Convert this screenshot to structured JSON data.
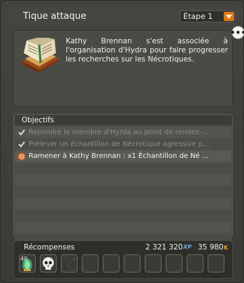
{
  "header": {
    "title": "Tique attaque",
    "step_selected": "Étape 1"
  },
  "description": {
    "text": "Kathy Brennan s'est associée à l'organisation d'Hydra pour faire progresser les recherches sur les Nécrotiques."
  },
  "objectives": {
    "header": "Objectifs",
    "items": [
      {
        "label": "Rejoindre le membre d'Hyrda au point de rendez-...",
        "status": "done"
      },
      {
        "label": "Prélever un échantillon de Nécrotique agressive p...",
        "status": "done"
      },
      {
        "label": "Ramener à Kathy Brennan : x1 Échantillon de Né ...",
        "status": "active"
      }
    ],
    "empty_rows": 7
  },
  "rewards": {
    "label": "Récompenses",
    "xp": "2 321 320",
    "xp_unit": "XP",
    "kamas": "35 980",
    "kamas_unit": "K",
    "items": [
      {
        "icon": "orb-item-icon",
        "quantity": "40"
      },
      {
        "icon": "skull-item-icon",
        "quantity": ""
      },
      {
        "icon": "weapon-item-icon",
        "quantity": ""
      }
    ],
    "empty_slots": 7
  },
  "colors": {
    "accent_orange": "#e0780c",
    "done_text": "#8e8e88",
    "active_quest": "#d25a1e"
  }
}
